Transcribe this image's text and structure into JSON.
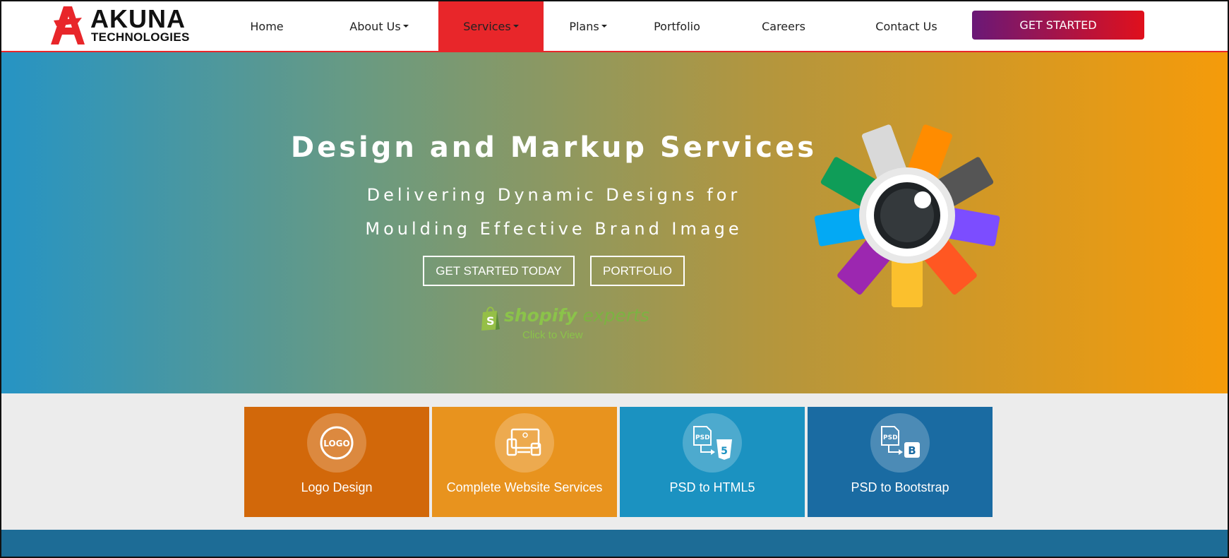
{
  "brand": {
    "name": "AKUNA",
    "tagline": "TECHNOLOGIES",
    "colors": {
      "primary_red": "#e8262a",
      "cta_start": "#6a1877",
      "cta_end": "#e0101c"
    }
  },
  "nav": {
    "items": [
      {
        "label": "Home",
        "has_dropdown": false
      },
      {
        "label": "About Us",
        "has_dropdown": true
      },
      {
        "label": "Services",
        "has_dropdown": true,
        "active": true
      },
      {
        "label": "Plans",
        "has_dropdown": true
      },
      {
        "label": "Portfolio",
        "has_dropdown": false
      },
      {
        "label": "Careers",
        "has_dropdown": false
      },
      {
        "label": "Contact Us",
        "has_dropdown": false
      }
    ],
    "cta_label": "GET STARTED"
  },
  "hero": {
    "title": "Design and Markup Services",
    "subtitle_line1": "Delivering Dynamic Designs for",
    "subtitle_line2": "Moulding Effective Brand Image",
    "primary_button": "GET STARTED TODAY",
    "secondary_button": "PORTFOLIO",
    "shopify_word": "shopify",
    "shopify_experts": "experts",
    "shopify_click": "Click to View"
  },
  "services": [
    {
      "label": "Logo Design",
      "icon": "logo-badge-icon",
      "icon_text": "LOGO",
      "color": "#d2680a"
    },
    {
      "label": "Complete Website Services",
      "icon": "devices-icon",
      "color": "#e8931e"
    },
    {
      "label": "PSD to HTML5",
      "icon": "psd-html5-icon",
      "icon_text": "PSD",
      "color": "#1b92c1"
    },
    {
      "label": "PSD to Bootstrap",
      "icon": "psd-bootstrap-icon",
      "icon_text": "PSD",
      "color": "#1a6ba2"
    }
  ]
}
